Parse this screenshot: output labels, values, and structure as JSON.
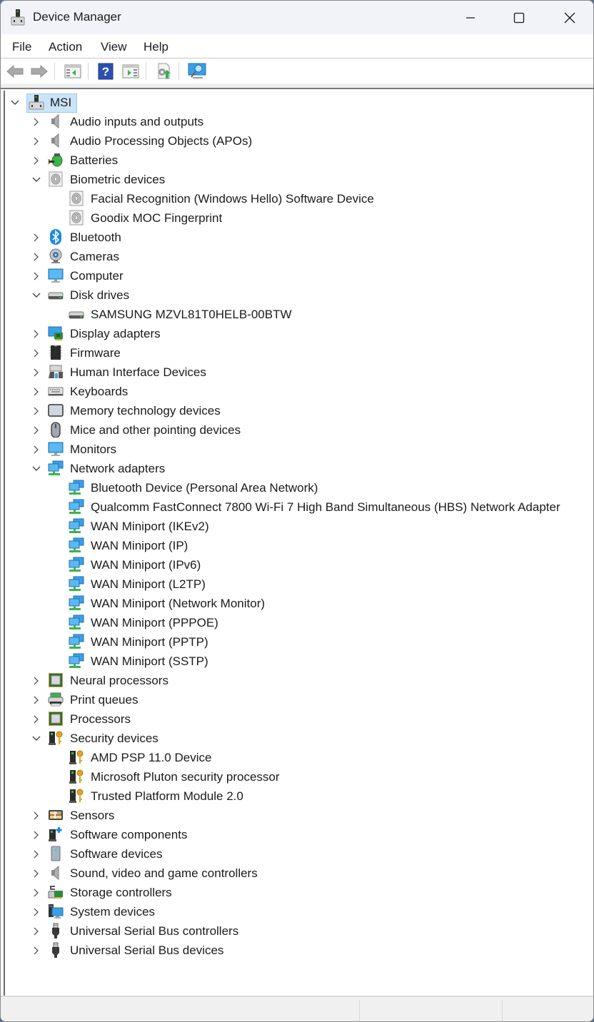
{
  "window": {
    "title": "Device Manager",
    "controls": {
      "minimize": "minimize",
      "maximize": "maximize",
      "close": "close"
    }
  },
  "menubar": {
    "items": [
      {
        "label": "File"
      },
      {
        "label": "Action"
      },
      {
        "label": "View"
      },
      {
        "label": "Help"
      }
    ]
  },
  "toolbar": {
    "buttons": [
      {
        "icon": "back-arrow-icon",
        "tooltip": "Back"
      },
      {
        "icon": "forward-arrow-icon",
        "tooltip": "Forward"
      },
      {
        "icon": "show-hide-console-tree-icon",
        "tooltip": "Show/Hide Console Tree"
      },
      {
        "icon": "help-icon",
        "tooltip": "Help"
      },
      {
        "icon": "show-hide-action-pane-icon",
        "tooltip": "Show/Hide Action Pane"
      },
      {
        "icon": "update-driver-icon",
        "tooltip": "Update Driver"
      },
      {
        "icon": "scan-hardware-changes-icon",
        "tooltip": "Scan for hardware changes"
      }
    ]
  },
  "tree": {
    "root": {
      "label": "MSI",
      "icon": "computer-root-icon",
      "expanded": true,
      "selected": true
    },
    "rows": [
      {
        "level": 1,
        "label": "Audio inputs and outputs",
        "icon": "speaker-icon",
        "expander": "collapsed"
      },
      {
        "level": 1,
        "label": "Audio Processing Objects (APOs)",
        "icon": "speaker-icon",
        "expander": "collapsed"
      },
      {
        "level": 1,
        "label": "Batteries",
        "icon": "battery-icon",
        "expander": "collapsed"
      },
      {
        "level": 1,
        "label": "Biometric devices",
        "icon": "fingerprint-icon",
        "expander": "expanded"
      },
      {
        "level": 2,
        "label": "Facial Recognition (Windows Hello) Software Device",
        "icon": "fingerprint-icon",
        "expander": "none"
      },
      {
        "level": 2,
        "label": "Goodix MOC Fingerprint",
        "icon": "fingerprint-icon",
        "expander": "none"
      },
      {
        "level": 1,
        "label": "Bluetooth",
        "icon": "bluetooth-icon",
        "expander": "collapsed"
      },
      {
        "level": 1,
        "label": "Cameras",
        "icon": "webcam-icon",
        "expander": "collapsed"
      },
      {
        "level": 1,
        "label": "Computer",
        "icon": "monitor-icon",
        "expander": "collapsed"
      },
      {
        "level": 1,
        "label": "Disk drives",
        "icon": "disk-drive-icon",
        "expander": "expanded"
      },
      {
        "level": 2,
        "label": "SAMSUNG MZVL81T0HELB-00BTW",
        "icon": "disk-drive-icon",
        "expander": "none"
      },
      {
        "level": 1,
        "label": "Display adapters",
        "icon": "display-adapter-icon",
        "expander": "collapsed"
      },
      {
        "level": 1,
        "label": "Firmware",
        "icon": "chip-icon",
        "expander": "collapsed"
      },
      {
        "level": 1,
        "label": "Human Interface Devices",
        "icon": "hid-icon",
        "expander": "collapsed"
      },
      {
        "level": 1,
        "label": "Keyboards",
        "icon": "keyboard-icon",
        "expander": "collapsed"
      },
      {
        "level": 1,
        "label": "Memory technology devices",
        "icon": "memory-device-icon",
        "expander": "collapsed"
      },
      {
        "level": 1,
        "label": "Mice and other pointing devices",
        "icon": "mouse-icon",
        "expander": "collapsed"
      },
      {
        "level": 1,
        "label": "Monitors",
        "icon": "monitor-icon",
        "expander": "collapsed"
      },
      {
        "level": 1,
        "label": "Network adapters",
        "icon": "network-adapter-icon",
        "expander": "expanded"
      },
      {
        "level": 2,
        "label": "Bluetooth Device (Personal Area Network)",
        "icon": "network-adapter-icon",
        "expander": "none"
      },
      {
        "level": 2,
        "label": "Qualcomm FastConnect 7800 Wi-Fi 7 High Band Simultaneous (HBS) Network Adapter",
        "icon": "network-adapter-icon",
        "expander": "none"
      },
      {
        "level": 2,
        "label": "WAN Miniport (IKEv2)",
        "icon": "network-adapter-icon",
        "expander": "none"
      },
      {
        "level": 2,
        "label": "WAN Miniport (IP)",
        "icon": "network-adapter-icon",
        "expander": "none"
      },
      {
        "level": 2,
        "label": "WAN Miniport (IPv6)",
        "icon": "network-adapter-icon",
        "expander": "none"
      },
      {
        "level": 2,
        "label": "WAN Miniport (L2TP)",
        "icon": "network-adapter-icon",
        "expander": "none"
      },
      {
        "level": 2,
        "label": "WAN Miniport (Network Monitor)",
        "icon": "network-adapter-icon",
        "expander": "none"
      },
      {
        "level": 2,
        "label": "WAN Miniport (PPPOE)",
        "icon": "network-adapter-icon",
        "expander": "none"
      },
      {
        "level": 2,
        "label": "WAN Miniport (PPTP)",
        "icon": "network-adapter-icon",
        "expander": "none"
      },
      {
        "level": 2,
        "label": "WAN Miniport (SSTP)",
        "icon": "network-adapter-icon",
        "expander": "none"
      },
      {
        "level": 1,
        "label": "Neural processors",
        "icon": "processor-icon",
        "expander": "collapsed"
      },
      {
        "level": 1,
        "label": "Print queues",
        "icon": "printer-icon",
        "expander": "collapsed"
      },
      {
        "level": 1,
        "label": "Processors",
        "icon": "processor-icon",
        "expander": "collapsed"
      },
      {
        "level": 1,
        "label": "Security devices",
        "icon": "security-key-icon",
        "expander": "expanded"
      },
      {
        "level": 2,
        "label": "AMD PSP 11.0 Device",
        "icon": "security-key-icon",
        "expander": "none"
      },
      {
        "level": 2,
        "label": "Microsoft Pluton security processor",
        "icon": "security-key-icon",
        "expander": "none"
      },
      {
        "level": 2,
        "label": "Trusted Platform Module 2.0",
        "icon": "security-key-icon",
        "expander": "none"
      },
      {
        "level": 1,
        "label": "Sensors",
        "icon": "sensor-map-icon",
        "expander": "collapsed"
      },
      {
        "level": 1,
        "label": "Software components",
        "icon": "software-component-icon",
        "expander": "collapsed"
      },
      {
        "level": 1,
        "label": "Software devices",
        "icon": "software-device-icon",
        "expander": "collapsed"
      },
      {
        "level": 1,
        "label": "Sound, video and game controllers",
        "icon": "speaker-icon",
        "expander": "collapsed"
      },
      {
        "level": 1,
        "label": "Storage controllers",
        "icon": "storage-controller-icon",
        "expander": "collapsed"
      },
      {
        "level": 1,
        "label": "System devices",
        "icon": "system-device-icon",
        "expander": "collapsed"
      },
      {
        "level": 1,
        "label": "Universal Serial Bus controllers",
        "icon": "usb-plug-icon",
        "expander": "collapsed"
      },
      {
        "level": 1,
        "label": "Universal Serial Bus devices",
        "icon": "usb-plug-icon",
        "expander": "collapsed"
      }
    ]
  },
  "statusbar": {
    "panes": [
      "",
      "",
      ""
    ]
  },
  "colors": {
    "titlebar_bg": "#f1f3f9",
    "selection_bg": "#cce4f7",
    "selection_border": "#99c9ef",
    "network_blue": "#3aa0e8",
    "network_green": "#3cb44b",
    "bluetooth_blue": "#1e88e5",
    "chip_green": "#2e6b3a",
    "key_gold": "#e0a526"
  }
}
